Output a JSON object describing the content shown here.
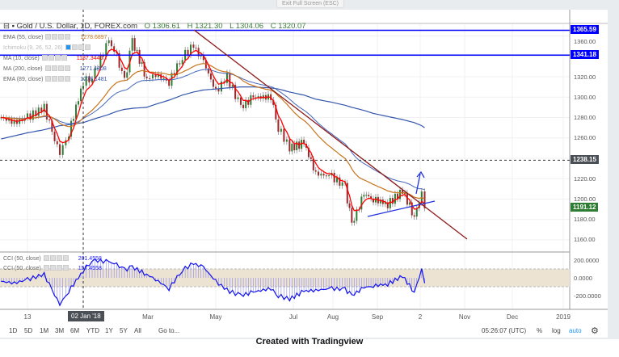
{
  "window": {
    "exit_fullscreen": "Exit Full Screen (ESC)"
  },
  "header": {
    "symbol": "Gold / U.S. Dollar, 1D, FOREX.com",
    "open": "O 1306.61",
    "high": "H 1321.30",
    "low": "L 1304.06",
    "close": "C 1320.07"
  },
  "indicators": [
    {
      "label": "EMA (55, close)",
      "value": "1278.6897",
      "color": "#c8741c"
    },
    {
      "label": "Ichimoku (9, 26, 52, 26)",
      "value": "",
      "color": "#999999"
    },
    {
      "label": "MA (10, close)",
      "value": "1187.3440",
      "color": "#ff0000"
    },
    {
      "label": "MA (200, close)",
      "value": "1271.4808",
      "color": "#3355aa"
    },
    {
      "label": "EMA (89, close)",
      "value": "1278.1481",
      "color": "#3355aa"
    }
  ],
  "cci_indicators": [
    {
      "label": "CCI (50, close)",
      "value": "201.4558"
    },
    {
      "label": "CCI (50, close)",
      "value": "157.4558"
    }
  ],
  "price_axis": {
    "ticks": [
      "1360.00",
      "1320.00",
      "1300.00",
      "1280.00",
      "1260.00",
      "1220.00",
      "1200.00",
      "1180.00",
      "1160.00"
    ],
    "tags": {
      "resistance_1": "1365.59",
      "resistance_2": "1341.18",
      "crosshair": "1238.15",
      "last": "1191.12"
    },
    "colors": {
      "resistance": "#0000ff",
      "crosshair": "#4a4f56",
      "last": "#2e7d32"
    }
  },
  "cci_axis": {
    "ticks": [
      "200.0000",
      "0.0000",
      "-200.0000"
    ]
  },
  "time_axis": {
    "labels": [
      "13",
      "Mar",
      "May",
      "Jul",
      "Aug",
      "Sep",
      "2",
      "Nov",
      "Dec",
      "2019"
    ],
    "crosshair": "02 Jan '18"
  },
  "bottom_bar": {
    "ranges": [
      "1D",
      "5D",
      "1M",
      "3M",
      "6M",
      "YTD",
      "1Y",
      "5Y",
      "All"
    ],
    "goto": "Go to...",
    "time": "05:26:07 (UTC)",
    "percent": "%",
    "log": "log",
    "auto": "auto",
    "settings_icon": "gear-icon"
  },
  "caption": "Created with Tradingview",
  "chart_data": {
    "type": "candlestick",
    "dates": [
      "2017-10-20",
      "2017-11-01",
      "2017-11-13",
      "2017-11-28",
      "2017-12-05",
      "2017-12-12",
      "2017-12-20",
      "2018-01-02",
      "2018-01-10",
      "2018-01-25",
      "2018-02-01",
      "2018-02-08",
      "2018-02-15",
      "2018-02-28",
      "2018-03-08",
      "2018-03-20",
      "2018-04-01",
      "2018-04-11",
      "2018-04-20",
      "2018-05-01",
      "2018-05-10",
      "2018-05-21",
      "2018-05-31",
      "2018-06-14",
      "2018-06-20",
      "2018-06-29",
      "2018-07-10",
      "2018-07-19",
      "2018-07-31",
      "2018-08-10",
      "2018-08-15",
      "2018-08-24",
      "2018-08-31",
      "2018-09-10",
      "2018-09-20",
      "2018-09-28",
      "2018-10-03",
      "2018-10-05"
    ],
    "close": [
      1280,
      1275,
      1280,
      1290,
      1265,
      1245,
      1265,
      1315,
      1320,
      1355,
      1340,
      1315,
      1355,
      1318,
      1322,
      1315,
      1340,
      1350,
      1335,
      1305,
      1320,
      1290,
      1300,
      1300,
      1270,
      1250,
      1255,
      1225,
      1222,
      1212,
      1175,
      1205,
      1200,
      1195,
      1208,
      1183,
      1205,
      1191
    ],
    "ma200": [
      1259,
      1262,
      1265,
      1268,
      1270,
      1272,
      1273,
      1275,
      1278,
      1283,
      1286,
      1288,
      1289,
      1290,
      1293,
      1297,
      1302,
      1305,
      1307,
      1308,
      1309,
      1310,
      1310,
      1309,
      1308,
      1305,
      1302,
      1298,
      1295,
      1292,
      1290,
      1287,
      1284,
      1281,
      1278,
      1275,
      1272,
      1270
    ],
    "horizontal_lines": [
      1365.59,
      1341.18
    ],
    "crosshair_price": 1238.15,
    "cci": [
      -40,
      -60,
      -20,
      40,
      -140,
      -300,
      -150,
      80,
      200,
      180,
      150,
      90,
      120,
      40,
      -20,
      -120,
      90,
      160,
      120,
      -40,
      -140,
      -200,
      -160,
      -120,
      -200,
      -240,
      -150,
      -140,
      -120,
      -130,
      -200,
      -110,
      -90,
      -70,
      20,
      -160,
      90,
      -60
    ],
    "cci_band": [
      -100,
      100
    ],
    "y_range": [
      1150,
      1372
    ],
    "cci_range": [
      -350,
      270
    ]
  }
}
